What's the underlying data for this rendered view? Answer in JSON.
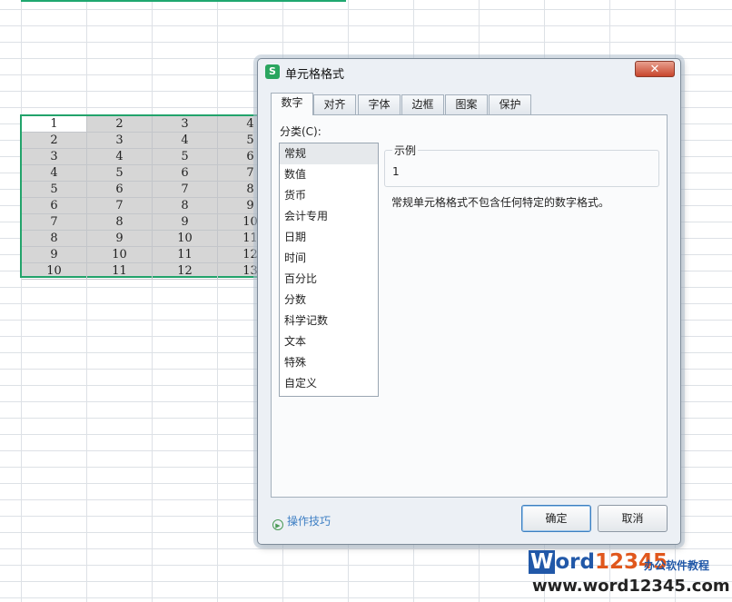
{
  "sheet": {
    "rows": [
      [
        "1",
        "2",
        "3",
        "4"
      ],
      [
        "2",
        "3",
        "4",
        "5"
      ],
      [
        "3",
        "4",
        "5",
        "6"
      ],
      [
        "4",
        "5",
        "6",
        "7"
      ],
      [
        "5",
        "6",
        "7",
        "8"
      ],
      [
        "6",
        "7",
        "8",
        "9"
      ],
      [
        "7",
        "8",
        "9",
        "10"
      ],
      [
        "8",
        "9",
        "10",
        "11"
      ],
      [
        "9",
        "10",
        "11",
        "12"
      ],
      [
        "10",
        "11",
        "12",
        "13"
      ]
    ],
    "colors": {
      "selection_border": "#22a36b",
      "selection_fill": "#d6d6d6"
    }
  },
  "dialog": {
    "title": "单元格格式",
    "app_icon_letter": "S",
    "close_symbol": "✕",
    "tabs": [
      {
        "label": "数字",
        "active": true
      },
      {
        "label": "对齐",
        "active": false
      },
      {
        "label": "字体",
        "active": false
      },
      {
        "label": "边框",
        "active": false
      },
      {
        "label": "图案",
        "active": false
      },
      {
        "label": "保护",
        "active": false
      }
    ],
    "category_label": "分类(C):",
    "categories": [
      "常规",
      "数值",
      "货币",
      "会计专用",
      "日期",
      "时间",
      "百分比",
      "分数",
      "科学记数",
      "文本",
      "特殊",
      "自定义"
    ],
    "selected_category": "常规",
    "sample_title": "示例",
    "sample_value": "1",
    "description": "常规单元格格式不包含任何特定的数字格式。",
    "tips_label": "操作技巧",
    "ok_label": "确定",
    "cancel_label": "取消"
  },
  "watermark": {
    "logo_w": "W",
    "logo_rest": "ord",
    "logo_num": "12345",
    "side_text": "办公软件教程",
    "url": "www.word12345.com"
  }
}
